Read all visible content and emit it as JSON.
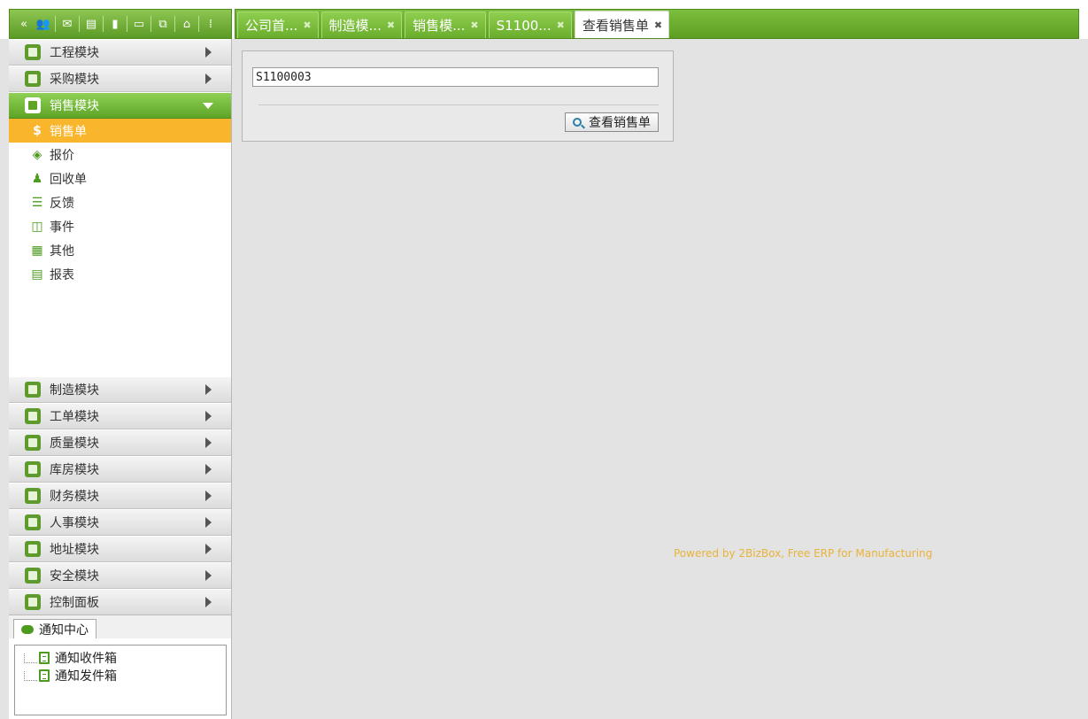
{
  "toolbar": {
    "icons": [
      "collapse-icon",
      "users-icon",
      "mail-icon",
      "document-icon",
      "chart-icon",
      "window-icon",
      "network-icon",
      "home-icon",
      "grip-icon"
    ]
  },
  "tabs": [
    {
      "label": "公司首...",
      "active": false
    },
    {
      "label": "制造模...",
      "active": false
    },
    {
      "label": "销售模...",
      "active": false
    },
    {
      "label": "S1100...",
      "active": false
    },
    {
      "label": "查看销售单",
      "active": true
    }
  ],
  "sidebar": {
    "modules_top": [
      {
        "label": "工程模块"
      },
      {
        "label": "采购模块"
      },
      {
        "label": "销售模块",
        "open": true
      }
    ],
    "sales_items": [
      {
        "label": "销售单",
        "selected": true
      },
      {
        "label": "报价"
      },
      {
        "label": "回收单"
      },
      {
        "label": "反馈"
      },
      {
        "label": "事件"
      },
      {
        "label": "其他"
      },
      {
        "label": "报表"
      }
    ],
    "modules_bottom": [
      {
        "label": "制造模块"
      },
      {
        "label": "工单模块"
      },
      {
        "label": "质量模块"
      },
      {
        "label": "库房模块"
      },
      {
        "label": "财务模块"
      },
      {
        "label": "人事模块"
      },
      {
        "label": "地址模块"
      },
      {
        "label": "安全模块"
      },
      {
        "label": "控制面板"
      }
    ]
  },
  "notifications": {
    "tab_label": "通知中心",
    "items": [
      "通知收件箱",
      "通知发件箱"
    ]
  },
  "main": {
    "order_number": "S1100003",
    "view_button": "查看销售单",
    "powered_by": "Powered by 2BizBox, Free ERP for Manufacturing"
  },
  "colors": {
    "accent_green": "#6aad2c",
    "selected_orange": "#f9b62d",
    "powered_text": "#e8b33a"
  }
}
